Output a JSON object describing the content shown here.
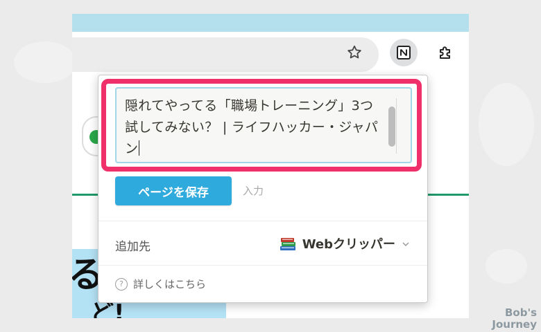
{
  "toolbar": {
    "star_icon": "bookmark-star-icon",
    "notion_icon": "notion-extension-icon",
    "extension_icon": "puzzle-extension-icon"
  },
  "clipper": {
    "page_title": "隠れてやってる「職場トレーニング」3つ試してみない？ | ライフハッカー・ジャパン",
    "save_button_label": "ページを保存",
    "input_label": "入力",
    "destination_label": "追加先",
    "destination_value": "Webクリッパー",
    "destination_icon": "books-icon",
    "help_text": "詳しくはこちら"
  },
  "background_page": {
    "heading_glyph": "る",
    "heading_glyph2": "ど!"
  },
  "watermark": {
    "line1": "Bob's",
    "line2": "Journey"
  },
  "colors": {
    "highlight": "#f0306b",
    "save_button": "#2eaadc",
    "tabstrip": "#b4e0ee",
    "accent_line": "#1f9a6a"
  }
}
